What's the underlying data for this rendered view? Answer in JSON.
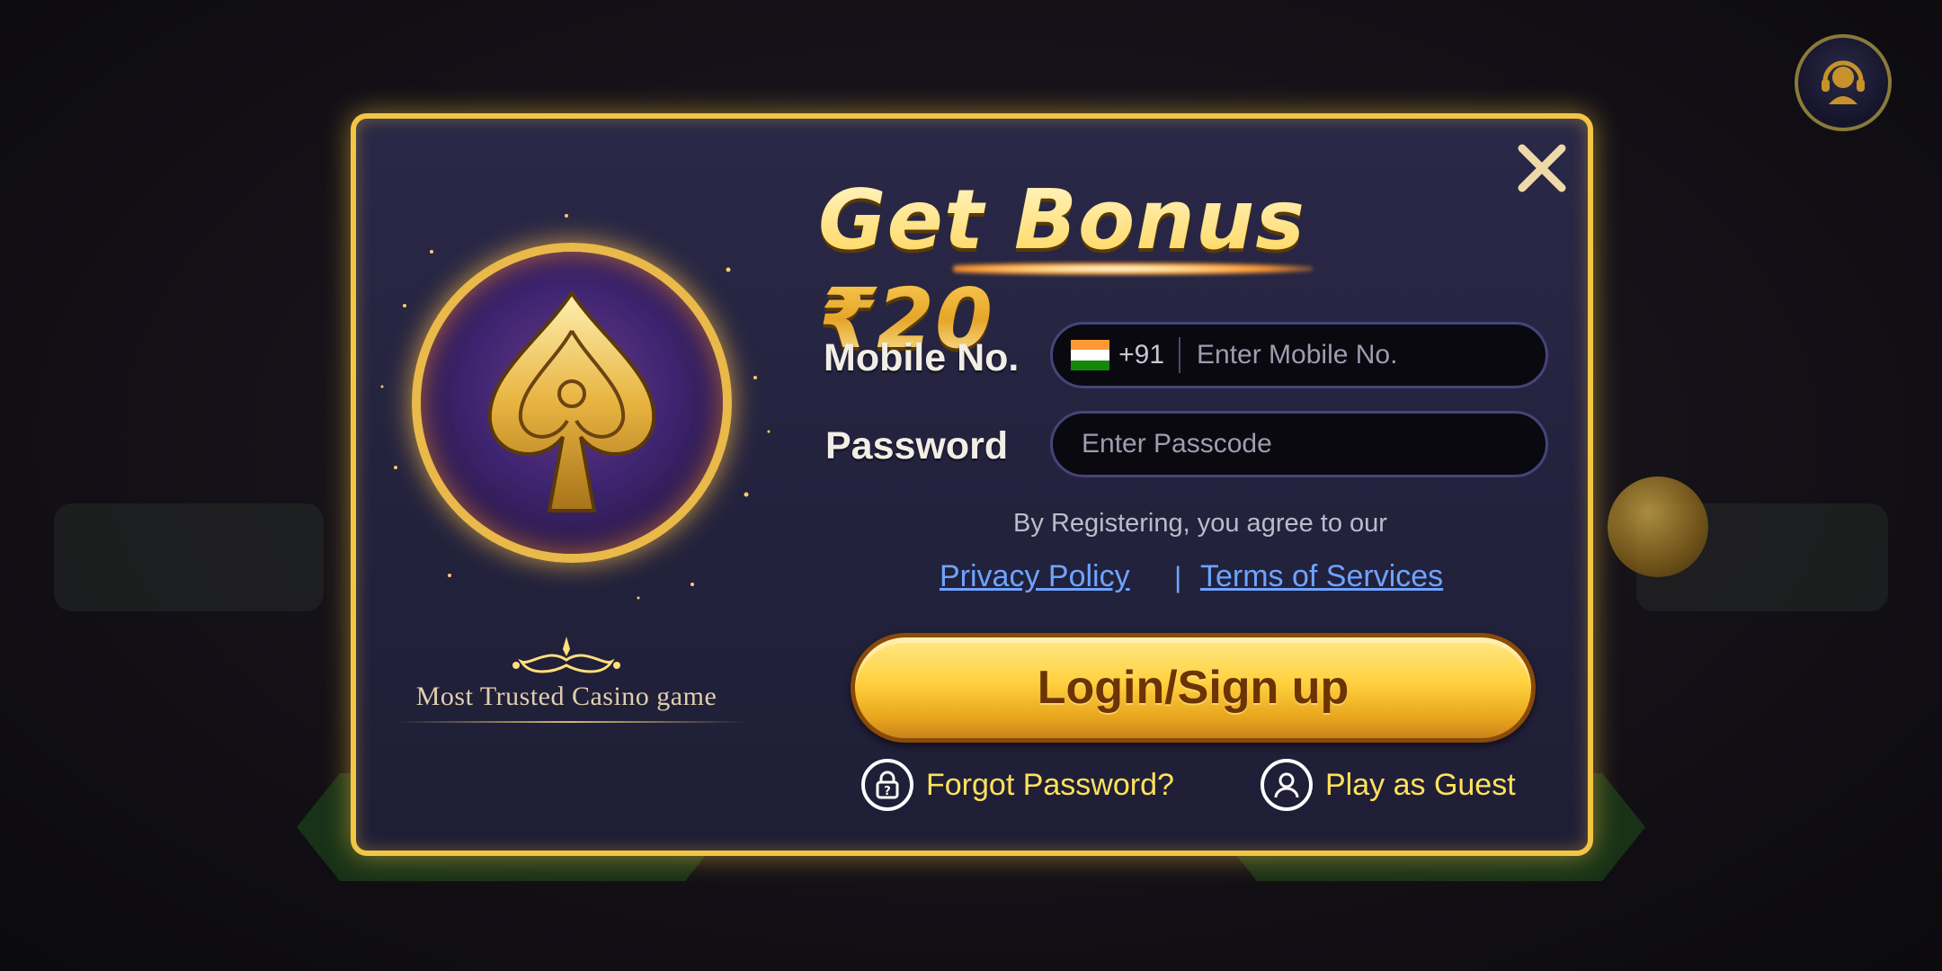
{
  "modal": {
    "title": "Get Bonus ₹20",
    "tagline": "Most Trusted Casino game"
  },
  "form": {
    "mobile_label": "Mobile No.",
    "country_code": "+91",
    "mobile_placeholder": "Enter Mobile No.",
    "password_label": "Password",
    "password_placeholder": "Enter Passcode"
  },
  "legal": {
    "agree_text": "By Registering, you agree to our",
    "privacy_label": "Privacy Policy",
    "separator": "|",
    "terms_label": "Terms of Services"
  },
  "actions": {
    "login_label": "Login/Sign up",
    "forgot_label": "Forgot Password?",
    "guest_label": "Play as Guest"
  },
  "icons": {
    "close": "close-icon",
    "support": "headset-icon",
    "flag": "india-flag-icon",
    "lock": "lock-question-icon",
    "guest": "user-icon",
    "emblem": "spade-emblem-icon"
  },
  "colors": {
    "accent_gold": "#f3c545",
    "link_blue": "#6fa3ff",
    "bottom_link_yellow": "#ffe25a",
    "modal_bg": "#23223d"
  }
}
